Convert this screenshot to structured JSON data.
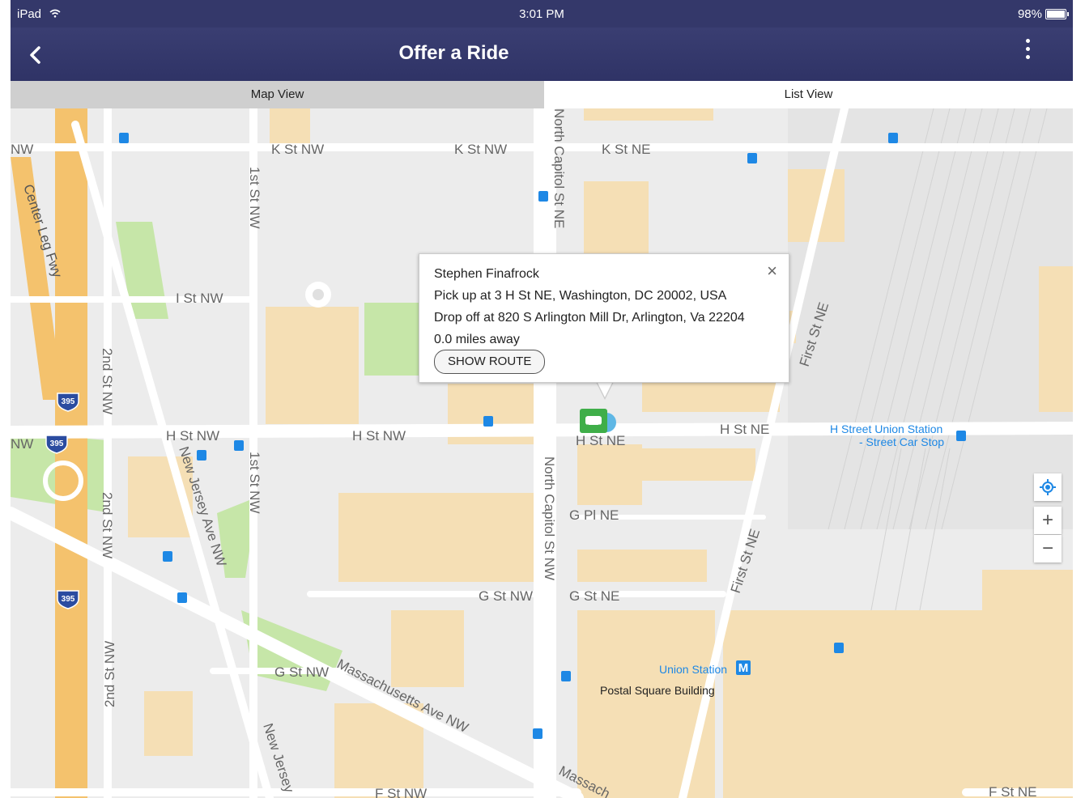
{
  "status_bar": {
    "device": "iPad",
    "time": "3:01 PM",
    "battery": "98%"
  },
  "nav": {
    "title": "Offer a Ride",
    "back_icon": "chevron-left-icon",
    "more_icon": "more-vertical-icon"
  },
  "tabs": [
    {
      "label": "Map View",
      "active": true
    },
    {
      "label": "List View",
      "active": false
    }
  ],
  "map": {
    "streets": [
      "K St NW",
      "K St NW",
      "K St NE",
      "I St NW",
      "H St NW",
      "H St NW",
      "H St NE",
      "H St NE",
      "G Pl NE",
      "G St NW",
      "G St NE",
      "G St NW",
      "F St NW",
      "F St NE",
      "1st St NW",
      "1st St NW",
      "2nd St NW",
      "2nd St NW",
      "2nd St NW",
      "North Capitol St NE",
      "North Capitol St NW",
      "First St NE",
      "First St NE",
      "New Jersey Ave NW",
      "New Jersey",
      "Center Leg Fwy",
      "Massachusetts Ave NW",
      "Massach",
      "NW",
      "NW"
    ],
    "highway_shield": "395",
    "pois": {
      "station_stop_line1": "H Street Union Station",
      "station_stop_line2": "- Street Car Stop",
      "union_station": "Union Station",
      "postal": "Postal Square Building"
    }
  },
  "popup": {
    "name": "Stephen Finafrock",
    "pickup": "Pick up at 3 H St NE, Washington, DC 20002, USA",
    "dropoff": "Drop off at 820 S Arlington Mill Dr, Arlington, Va 22204",
    "distance": "0.0 miles away",
    "button": "SHOW ROUTE",
    "close": "×"
  },
  "controls": {
    "locate_icon": "locate-icon",
    "zoom_in": "+",
    "zoom_out": "−"
  },
  "colors": {
    "nav": "#34386a",
    "transit": "#1e88e5",
    "buildings": "#f5dfb5",
    "park": "#c6e6a8",
    "highway": "#f4c26d",
    "car_marker": "#3fae49"
  }
}
